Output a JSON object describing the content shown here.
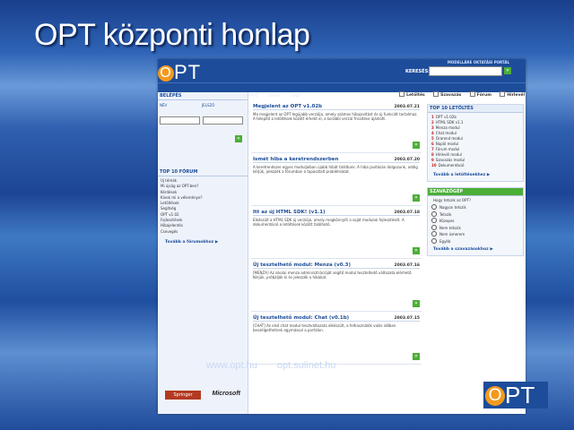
{
  "slide": {
    "title": "OPT központi honlap"
  },
  "site": {
    "logo_o": "O",
    "logo_rest": "PT",
    "toplinks": "MODELLÁRE  OKTATÁSI PORTÁL",
    "search": {
      "label": "KERESÉS:",
      "go": "»"
    },
    "navbar": [
      "Nyitólap",
      "Fórum",
      "Letöltések",
      "Hírek",
      "Linkek",
      "Súgó"
    ],
    "tabs": [
      "Letöltés",
      "Szavazás",
      "Fórum",
      "Hírlevél"
    ]
  },
  "login": {
    "title": "BELÉPÉS",
    "user_label": "NÉV",
    "pass_label": "JELSZÓ",
    "go": "»"
  },
  "forum": {
    "title": "TOP 10 FÓRUM",
    "items": [
      "Új témák",
      "Mi újság az OPT-ben?",
      "Kérdések",
      "Kinek mi a véleménye?",
      "Letöltések",
      "Segítség",
      "OPT v1.02",
      "Fejlesztések",
      "Hibajelentés",
      "Csevegés"
    ],
    "more": "Tovább a fórumokhoz ▶"
  },
  "articles": [
    {
      "title": "Megjelent az OPT v1.02b",
      "date": "2003.07.21",
      "body": "Ma megjelent az OPT legújabb verziója, amely számos hibajavítást és új funkciót tartalmaz. A telepítő a letöltések között érhető el, a korábbi verzió frissítése ajánlott."
    },
    {
      "title": "Ismét hiba a keretrendszerben",
      "date": "2003.07.20",
      "body": "A keretrendszer egyes moduljaiban újabb hibát találtunk. A hiba javításán dolgozunk, addig kérjük, jelezzék a fórumban a tapasztalt problémákat."
    },
    {
      "title": "Itt az új HTML SDK! (v1.1)",
      "date": "2003.07.18",
      "body": "Elkészült a HTML SDK új verziója, amely megkönnyíti a saját modulok fejlesztését. A dokumentáció a letöltések között található."
    },
    {
      "title": "Új tesztelhető modul: Menza (v0.3)",
      "date": "2003.07.16",
      "body": "[MENZA] Az iskolai menza adminisztrációját segítő modul tesztelhető változata elérhető. Kérjük, próbálják ki és jelezzék a hibákat."
    },
    {
      "title": "Új tesztelhető modul: Chat (v0.1b)",
      "date": "2003.07.15",
      "body": "[CHAT] Az első chat modul tesztváltozata elkészült, a felhasználók valós időben beszélgethetnek egymással a portálon."
    }
  ],
  "downloads": {
    "title": "TOP 10 LETÖLTÉS",
    "items": [
      "OPT v1.02b",
      "HTML SDK v1.1",
      "Menza modul",
      "Chat modul",
      "Órarend modul",
      "Napló modul",
      "Fórum modul",
      "Hírlevél modul",
      "Szavazás modul",
      "Dokumentáció"
    ],
    "more": "Tovább a letöltésekhez ▶"
  },
  "poll": {
    "title": "SZAVAZÓGÉP",
    "question": "Hogy tetszik az OPT?",
    "options": [
      "Nagyon tetszik",
      "Tetszik",
      "Közepes",
      "Nem tetszik",
      "Nem ismerem",
      "Egyéb"
    ],
    "more": "Tovább a szavazásokhoz ▶"
  },
  "footer": {
    "springer": "Springer",
    "microsoft": "Microsoft",
    "url1": "www.opt.hu",
    "url2": "opt.sulinet.hu"
  },
  "corner_logo": {
    "o": "O",
    "rest": "PT"
  },
  "colors": {
    "brand_blue": "#1d4d9a",
    "accent_orange": "#f39a1e",
    "go_green": "#4cae37"
  }
}
